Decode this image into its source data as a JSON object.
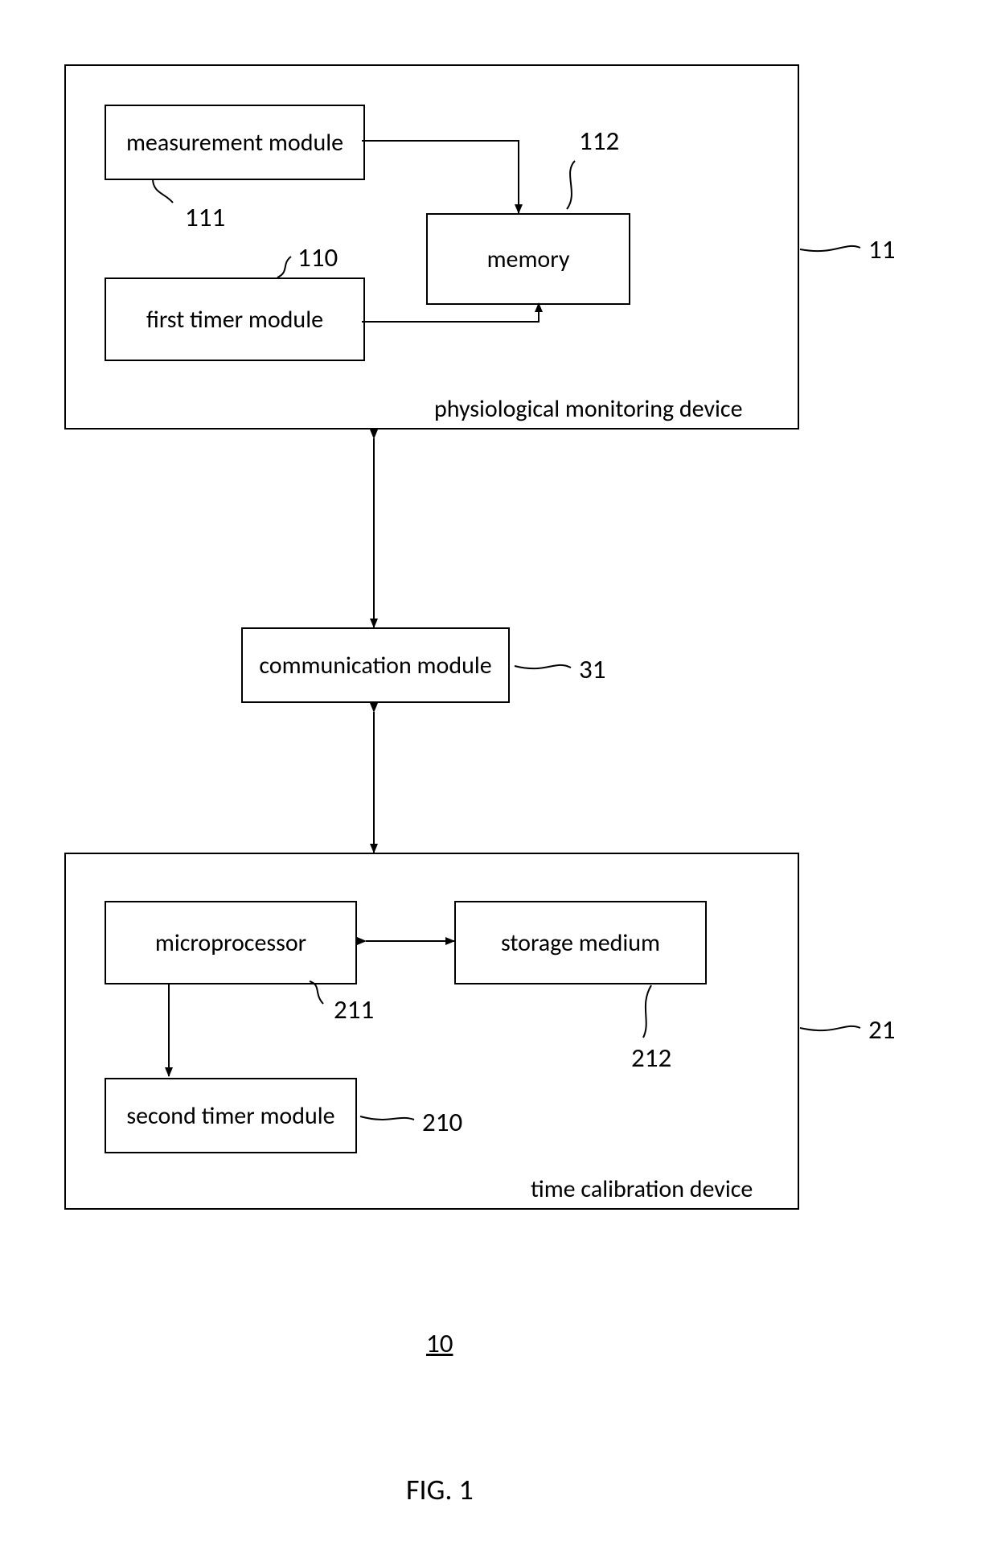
{
  "boxes": {
    "measurement": "measurement module",
    "memory": "memory",
    "first_timer": "first timer module",
    "communication": "communication module",
    "microprocessor": "microprocessor",
    "storage": "storage medium",
    "second_timer": "second timer module"
  },
  "outer_labels": {
    "phys_device": "physiological monitoring device",
    "time_calib": "time calibration device"
  },
  "refs": {
    "r111": "111",
    "r112": "112",
    "r110": "110",
    "r11": "11",
    "r31": "31",
    "r211": "211",
    "r212": "212",
    "r210": "210",
    "r21": "21"
  },
  "figure_number": "10",
  "figure_caption": "FIG. 1"
}
